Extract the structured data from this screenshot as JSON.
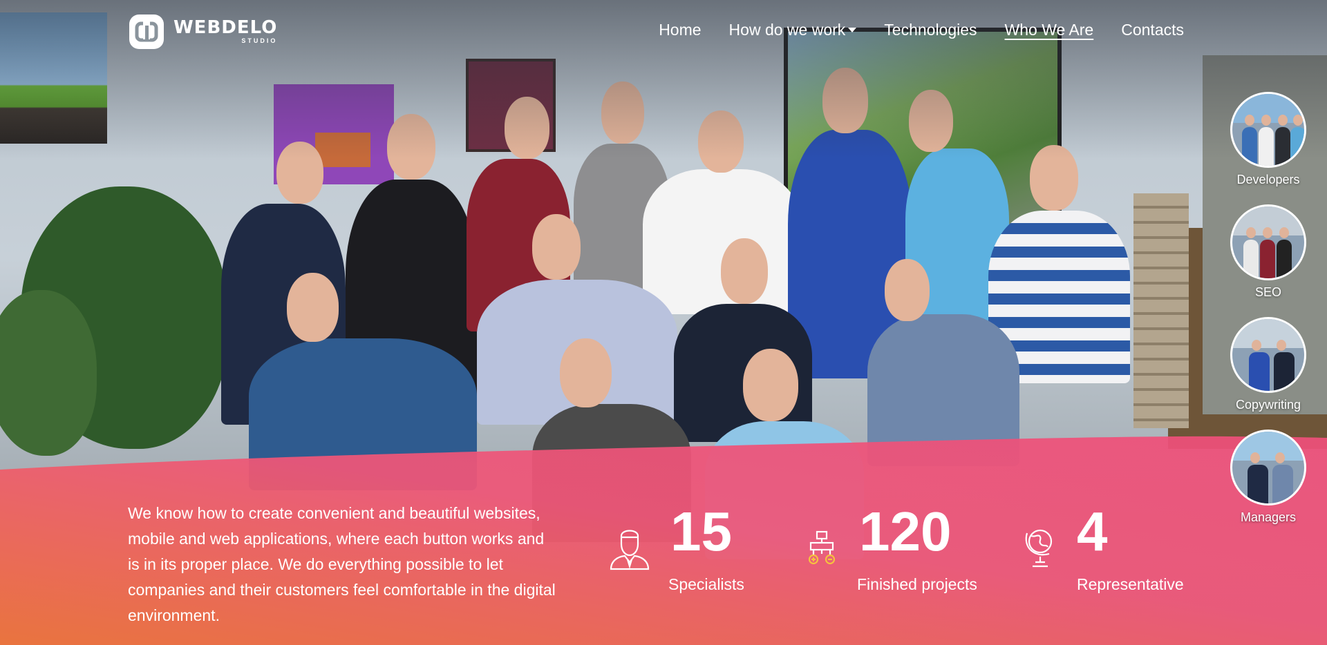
{
  "brand": {
    "name": "WEBDELO",
    "tagline": "STUDIO"
  },
  "nav": {
    "items": [
      {
        "label": "Home"
      },
      {
        "label": "How do we work"
      },
      {
        "label": "Technologies"
      },
      {
        "label": "Who We Are"
      },
      {
        "label": "Contacts"
      }
    ]
  },
  "side_menu": {
    "items": [
      {
        "label": "Developers"
      },
      {
        "label": "SEO"
      },
      {
        "label": "Copywriting"
      },
      {
        "label": "Managers"
      }
    ]
  },
  "intro": {
    "text": "We know how to create convenient and beautiful websites, mobile and web applications, where each button works and is in its proper place. We do everything possible to let companies and their customers feel comfortable in the digital environment."
  },
  "stats": [
    {
      "value": "15",
      "label": "Specialists",
      "icon": "person-tie-icon"
    },
    {
      "value": "120",
      "label": "Finished projects",
      "icon": "project-structure-icon"
    },
    {
      "value": "4",
      "label": "Representative",
      "icon": "globe-icon"
    }
  ],
  "colors": {
    "band_start": "#f07238",
    "band_end": "#ee4f7a",
    "text": "#ffffff"
  }
}
